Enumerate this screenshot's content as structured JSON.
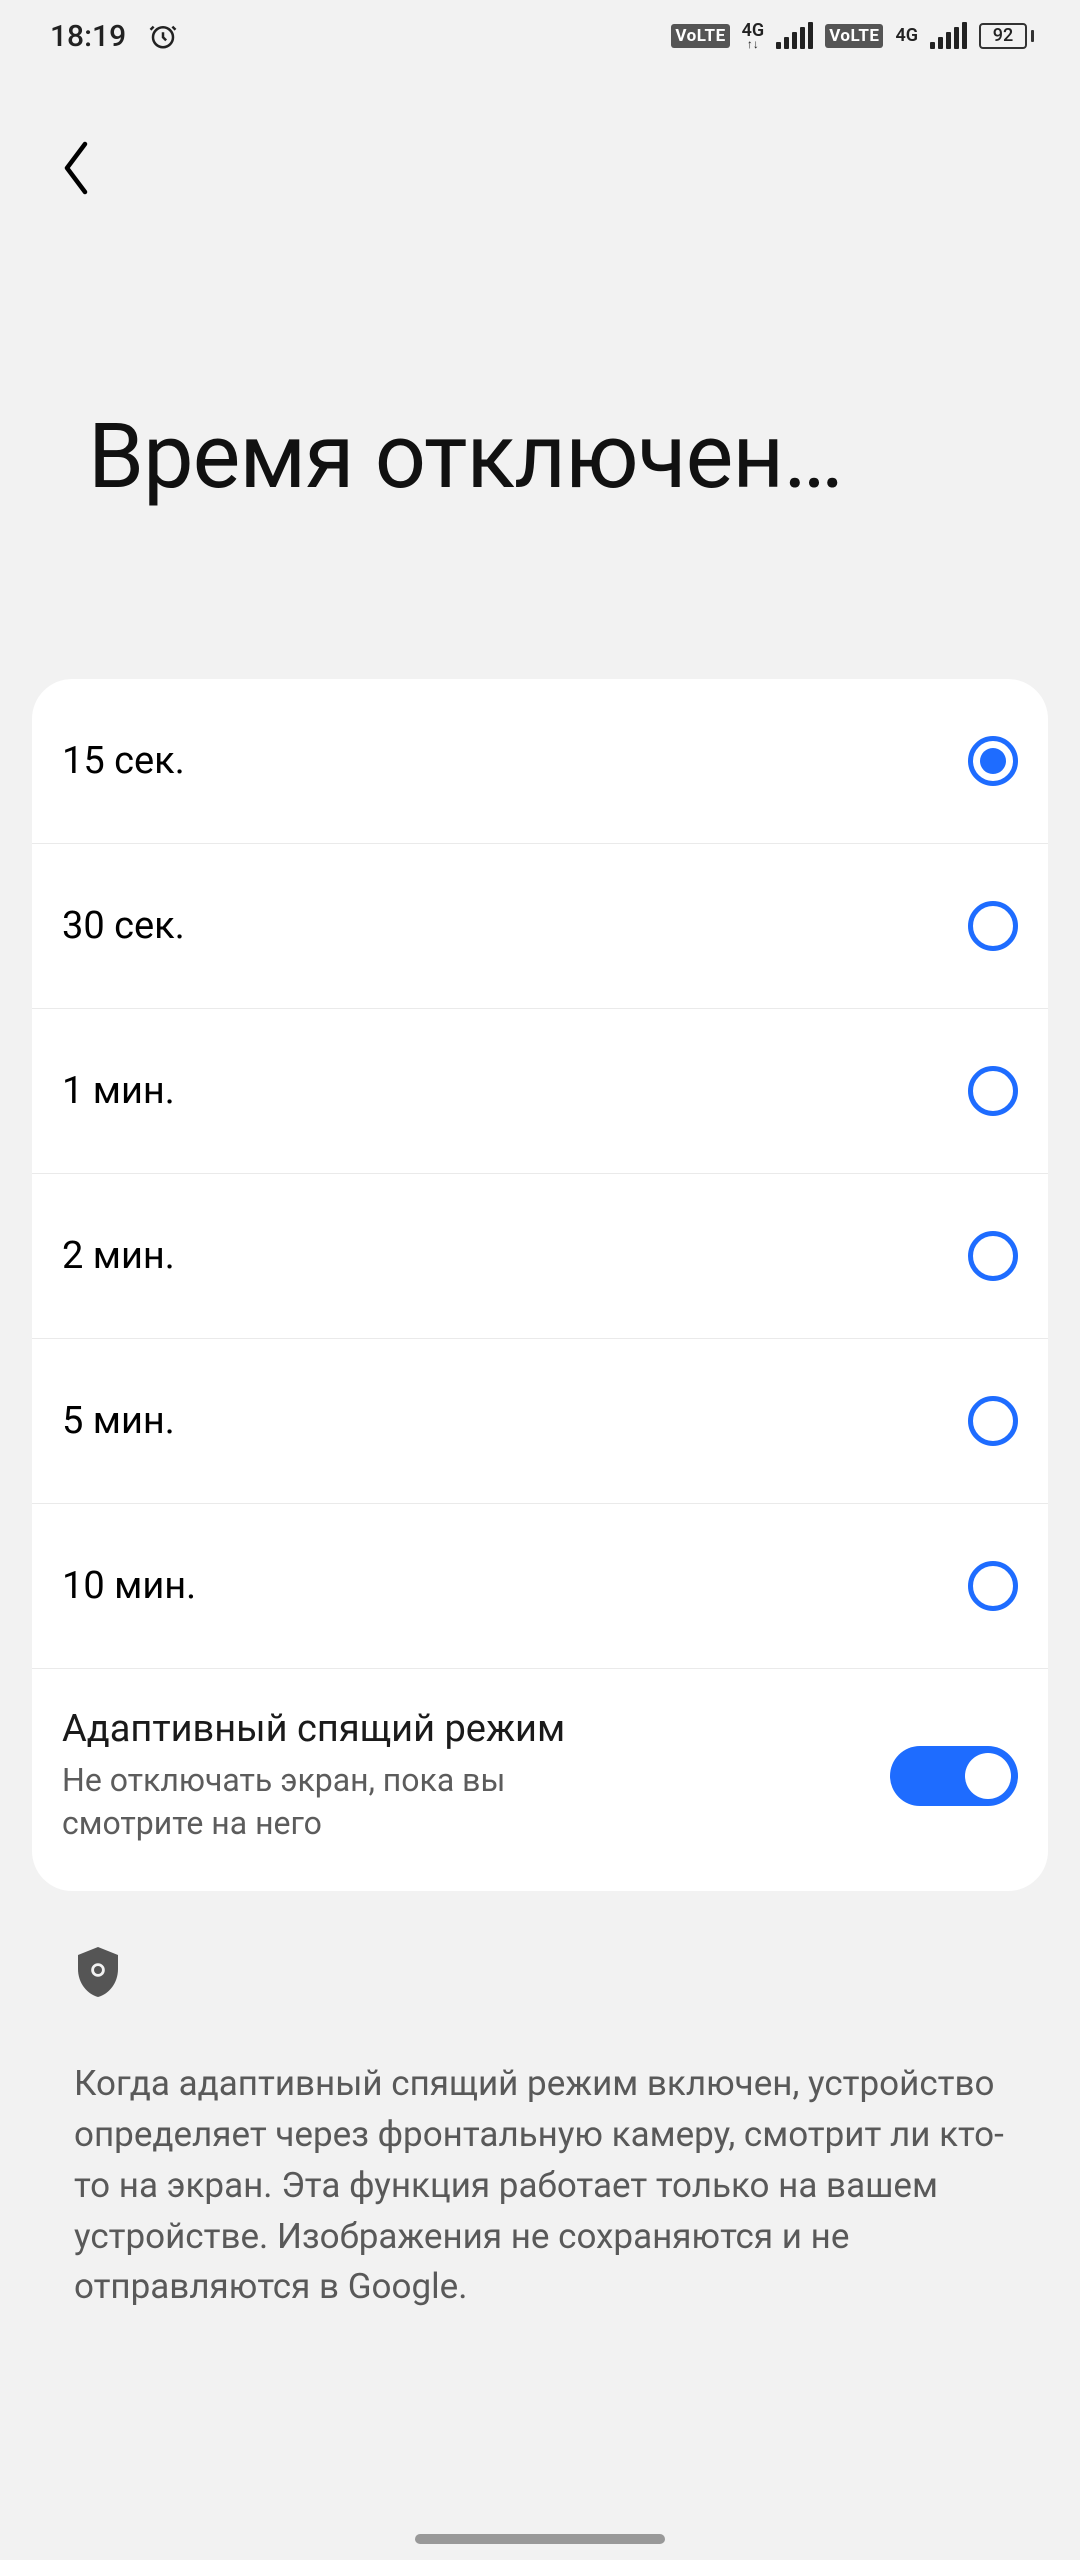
{
  "status": {
    "time": "18:19",
    "network_label": "4G",
    "battery_level": "92",
    "volte": "VoLTE"
  },
  "title": "Время отключен…",
  "radio_options": [
    {
      "label": "15 сек.",
      "checked": true
    },
    {
      "label": "30 сек.",
      "checked": false
    },
    {
      "label": "1 мин.",
      "checked": false
    },
    {
      "label": "2 мин.",
      "checked": false
    },
    {
      "label": "5 мин.",
      "checked": false
    },
    {
      "label": "10 мин.",
      "checked": false
    }
  ],
  "adaptive": {
    "title": "Адаптивный спящий режим",
    "subtitle": "Не отключать экран, пока вы смотрите на него",
    "enabled": true
  },
  "info_text": "Когда адаптивный спящий режим включен, устройство определяет через фронтальную камеру, смотрит ли кто-то на экран. Эта функция работает только на вашем устройстве. Изображения не сохраняются и не отправляются в Google."
}
